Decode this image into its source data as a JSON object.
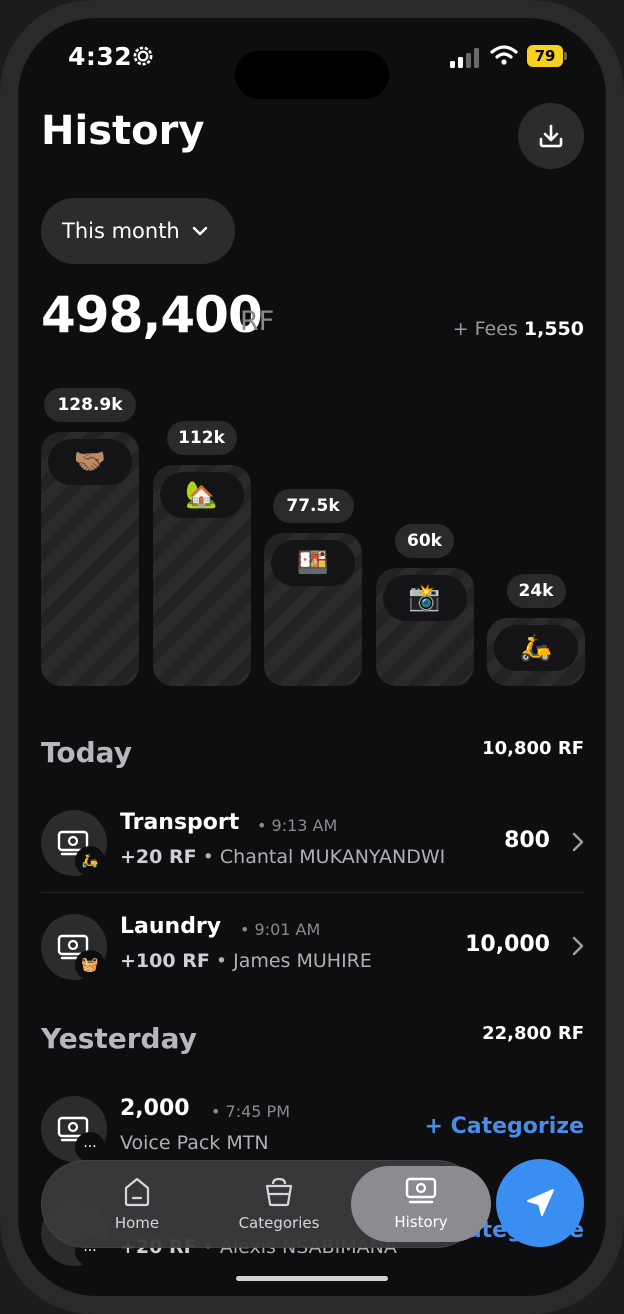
{
  "status": {
    "time": "4:32",
    "battery": "79"
  },
  "header": {
    "title": "History"
  },
  "filter": {
    "period": "This month"
  },
  "summary": {
    "total": "498,400",
    "currency": "RF",
    "fees_label": "+ Fees",
    "fees_value": "1,550"
  },
  "chart_data": {
    "type": "bar",
    "categories": [
      "handshake",
      "house",
      "bento",
      "camera",
      "scooter"
    ],
    "values": [
      128900,
      112000,
      77500,
      60000,
      24000
    ],
    "labels": [
      "128.9k",
      "112k",
      "77.5k",
      "60k",
      "24k"
    ]
  },
  "bar_icons": [
    "🤝🏽",
    "🏡",
    "🍱",
    "📸",
    "🛵"
  ],
  "today": {
    "title": "Today",
    "total": "10,800 RF",
    "items": [
      {
        "name": "Transport",
        "time": "• 9:13 AM",
        "fee": "+20 RF",
        "party": "• Chantal MUKANYANDWI",
        "amount": "800",
        "icon": "🛵"
      },
      {
        "name": "Laundry",
        "time": "• 9:01 AM",
        "fee": "+100 RF",
        "party": "• James MUHIRE",
        "amount": "10,000",
        "icon": "🧺"
      }
    ]
  },
  "yesterday": {
    "title": "Yesterday",
    "total": "22,800 RF",
    "items": [
      {
        "name": "2,000",
        "time": "• 7:45 PM",
        "party": "Voice Pack MTN",
        "action": "+ Categorize",
        "icon": "···"
      },
      {
        "name": "",
        "fee": "+20 RF",
        "party": "• Alexis NSABIMANA",
        "action": "+ Categorize",
        "icon": "···"
      }
    ]
  },
  "tabs": [
    {
      "label": "Home",
      "icon": "home-icon"
    },
    {
      "label": "Categories",
      "icon": "categories-icon"
    },
    {
      "label": "History",
      "icon": "history-icon"
    }
  ],
  "colors": {
    "accent": "#3a8ef2",
    "link": "#4a8de8",
    "battery": "#f7d11e"
  }
}
